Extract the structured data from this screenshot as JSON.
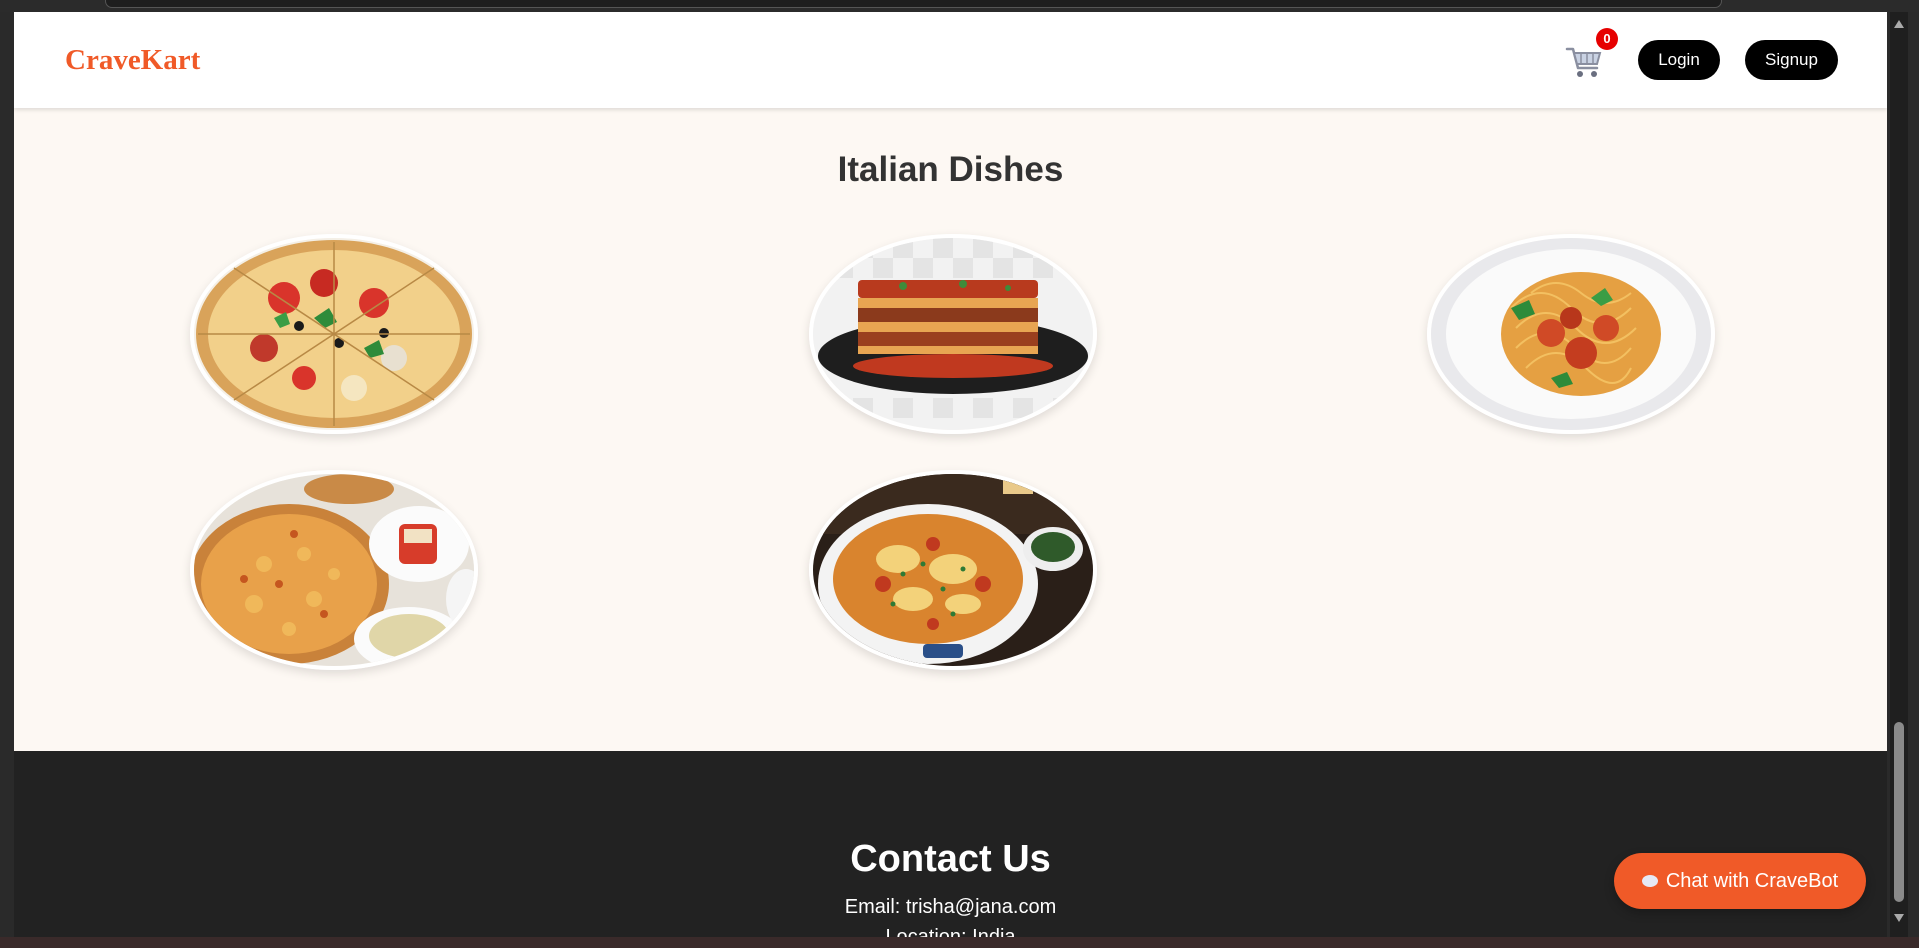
{
  "header": {
    "brand": "CraveKart",
    "cart_count": "0",
    "login_label": "Login",
    "signup_label": "Signup"
  },
  "main": {
    "title": "Italian Dishes",
    "dishes": [
      {
        "icon": "pizza-image"
      },
      {
        "icon": "lasagna-image"
      },
      {
        "icon": "spaghetti-image"
      },
      {
        "icon": "pizza-platter-image"
      },
      {
        "icon": "baked-lasagna-image"
      }
    ]
  },
  "footer": {
    "title": "Contact Us",
    "email_line": "Email: trisha@jana.com",
    "location_line": "Location: India"
  },
  "chat": {
    "label": "Chat with CraveBot"
  },
  "colors": {
    "brand": "#f05a28",
    "page_bg": "#fdf8f3",
    "footer_bg": "#222222",
    "badge": "#e60000"
  }
}
